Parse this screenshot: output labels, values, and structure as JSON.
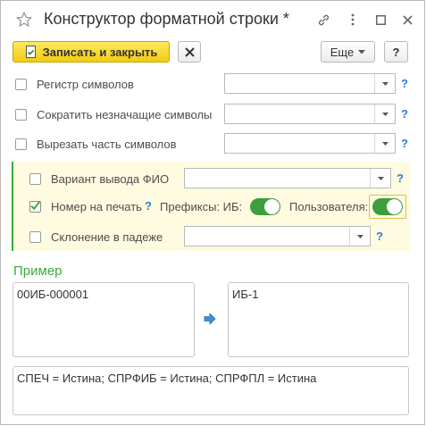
{
  "window": {
    "title": "Конструктор форматной строки *"
  },
  "toolbar": {
    "save_close_label": "Записать и закрыть",
    "more_label": "Еще",
    "help_label": "?"
  },
  "options": [
    {
      "label": "Регистр символов",
      "checked": false
    },
    {
      "label": "Сократить незначащие символы",
      "checked": false
    },
    {
      "label": "Вырезать часть символов",
      "checked": false
    }
  ],
  "group": {
    "fio_label": "Вариант вывода ФИО",
    "print_number_label": "Номер на печать",
    "print_number_checked": true,
    "prefix_ib_label": "Префиксы: ИБ:",
    "user_label": "Пользователя:",
    "prefix_ib_on": true,
    "user_on": true,
    "case_label": "Склонение в падеже"
  },
  "example": {
    "title": "Пример",
    "input_value": "00ИБ-000001",
    "output_value": "ИБ-1",
    "params_value": "СПЕЧ = Истина; СПРФИБ = Истина; СПРФПЛ = Истина"
  },
  "help_mark": "?",
  "colors": {
    "accent_green": "#3aa93a",
    "button_yellow": "#f7d830",
    "help_blue": "#2f7ad6",
    "group_bg": "#fffbe0"
  }
}
